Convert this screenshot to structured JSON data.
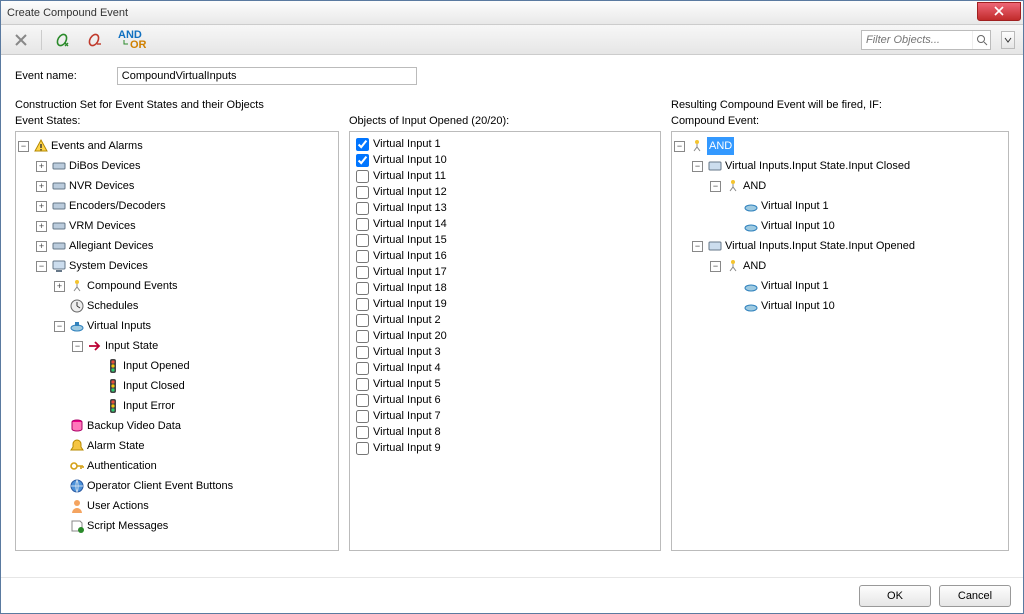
{
  "window": {
    "title": "Create Compound Event"
  },
  "toolbar": {
    "and_or": "AND\nOR"
  },
  "filter": {
    "placeholder": "Filter Objects..."
  },
  "form": {
    "name_label": "Event name:",
    "name_value": "CompoundVirtualInputs"
  },
  "sections": {
    "left_header": "Construction Set for Event States and their Objects",
    "right_header": "Resulting Compound Event will be fired, IF:",
    "left_sub": "Event States:",
    "mid_sub": "Objects of Input Opened (20/20):",
    "right_sub": "Compound Event:"
  },
  "event_tree": {
    "root": "Events and Alarms",
    "items": {
      "dibos": "DiBos Devices",
      "nvr": "NVR Devices",
      "enc": "Encoders/Decoders",
      "vrm": "VRM Devices",
      "allegiant": "Allegiant Devices",
      "system": "System Devices",
      "compound": "Compound Events",
      "schedules": "Schedules",
      "vinputs": "Virtual Inputs",
      "istate": "Input State",
      "iopen": "Input Opened",
      "iclosed": "Input Closed",
      "ierror": "Input Error",
      "backup": "Backup Video Data",
      "alarm": "Alarm State",
      "auth": "Authentication",
      "opclient": "Operator Client Event Buttons",
      "uactions": "User Actions",
      "script": "Script Messages"
    }
  },
  "objects": [
    {
      "label": "Virtual Input 1",
      "checked": true
    },
    {
      "label": "Virtual Input 10",
      "checked": true
    },
    {
      "label": "Virtual Input 11",
      "checked": false
    },
    {
      "label": "Virtual Input 12",
      "checked": false
    },
    {
      "label": "Virtual Input 13",
      "checked": false
    },
    {
      "label": "Virtual Input 14",
      "checked": false
    },
    {
      "label": "Virtual Input 15",
      "checked": false
    },
    {
      "label": "Virtual Input 16",
      "checked": false
    },
    {
      "label": "Virtual Input 17",
      "checked": false
    },
    {
      "label": "Virtual Input 18",
      "checked": false
    },
    {
      "label": "Virtual Input 19",
      "checked": false
    },
    {
      "label": "Virtual Input 2",
      "checked": false
    },
    {
      "label": "Virtual Input 20",
      "checked": false
    },
    {
      "label": "Virtual Input 3",
      "checked": false
    },
    {
      "label": "Virtual Input 4",
      "checked": false
    },
    {
      "label": "Virtual Input 5",
      "checked": false
    },
    {
      "label": "Virtual Input 6",
      "checked": false
    },
    {
      "label": "Virtual Input 7",
      "checked": false
    },
    {
      "label": "Virtual Input 8",
      "checked": false
    },
    {
      "label": "Virtual Input 9",
      "checked": false
    }
  ],
  "compound": {
    "root": "AND",
    "closed": "Virtual Inputs.Input State.Input Closed",
    "and1": "AND",
    "vi1": "Virtual Input 1",
    "vi10": "Virtual Input 10",
    "opened": "Virtual Inputs.Input State.Input Opened",
    "and2": "AND",
    "vi1b": "Virtual Input 1",
    "vi10b": "Virtual Input 10"
  },
  "footer": {
    "ok": "OK",
    "cancel": "Cancel"
  }
}
